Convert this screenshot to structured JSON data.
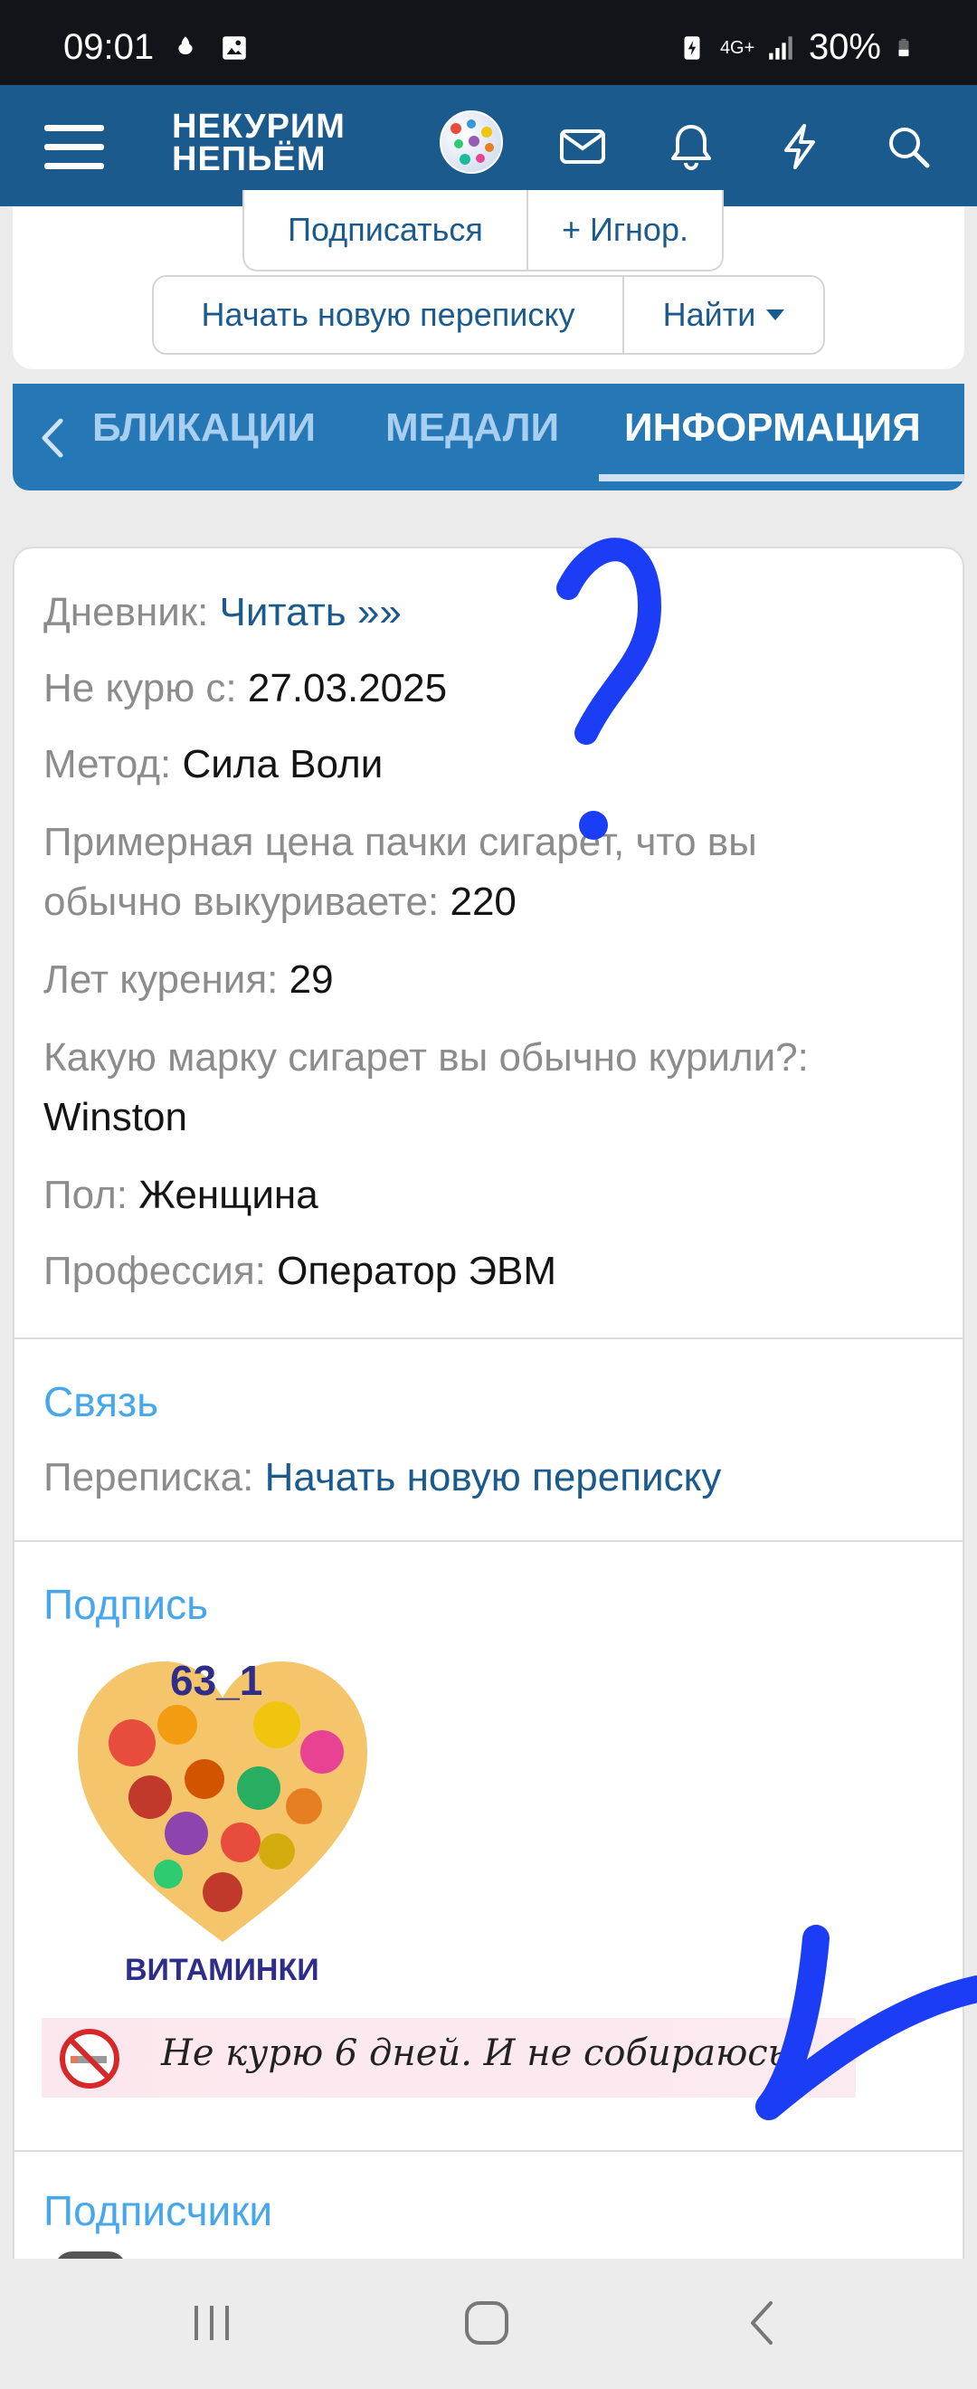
{
  "status_bar": {
    "time": "09:01",
    "network": "4G+",
    "battery": "30%"
  },
  "header": {
    "logo_line1": "НЕКУРИМ",
    "logo_line2": "НЕПЬЁМ",
    "icons": [
      "menu-icon",
      "avatar",
      "mail-icon",
      "bell-icon",
      "lightning-icon",
      "search-icon"
    ]
  },
  "actions": {
    "subscribe": "Подписаться",
    "ignore": "+ Игнор.",
    "new_conversation": "Начать новую переписку",
    "find": "Найти"
  },
  "tabs": {
    "items": [
      {
        "label": "БЛИКАЦИИ",
        "active": false
      },
      {
        "label": "МЕДАЛИ",
        "active": false
      },
      {
        "label": "ИНФОРМАЦИЯ",
        "active": true
      }
    ]
  },
  "info": {
    "diary_label": "Дневник:",
    "diary_value": "Читать »»",
    "quit_label": "Не курю с:",
    "quit_value": "27.03.2025",
    "method_label": "Метод:",
    "method_value": "Сила Воли",
    "price_label_1": "Примерная цена пачки сигарет, что вы",
    "price_label_2": "обычно выкуриваете:",
    "price_value": "220",
    "years_label": "Лет курения:",
    "years_value": "29",
    "brand_label": "Какую марку сигарет вы обычно курили?:",
    "brand_value": "Winston",
    "gender_label": "Пол:",
    "gender_value": "Женщина",
    "job_label": "Профессия:",
    "job_value": "Оператор ЭВМ"
  },
  "contact": {
    "title": "Связь",
    "conv_label": "Переписка:",
    "conv_value": "Начать новую переписку"
  },
  "signature": {
    "title": "Подпись",
    "image_number": "63_1",
    "image_caption": "ВИТАМИНКИ",
    "banner_text": "Не курю 6 дней. И не собираюсь!"
  },
  "followers": {
    "title": "Подписчики"
  },
  "colors": {
    "header": "#1a5a8c",
    "tabs": "#2577b5",
    "link": "#1a5a8c",
    "section": "#47a7eb",
    "annotation": "#1a3df5"
  }
}
